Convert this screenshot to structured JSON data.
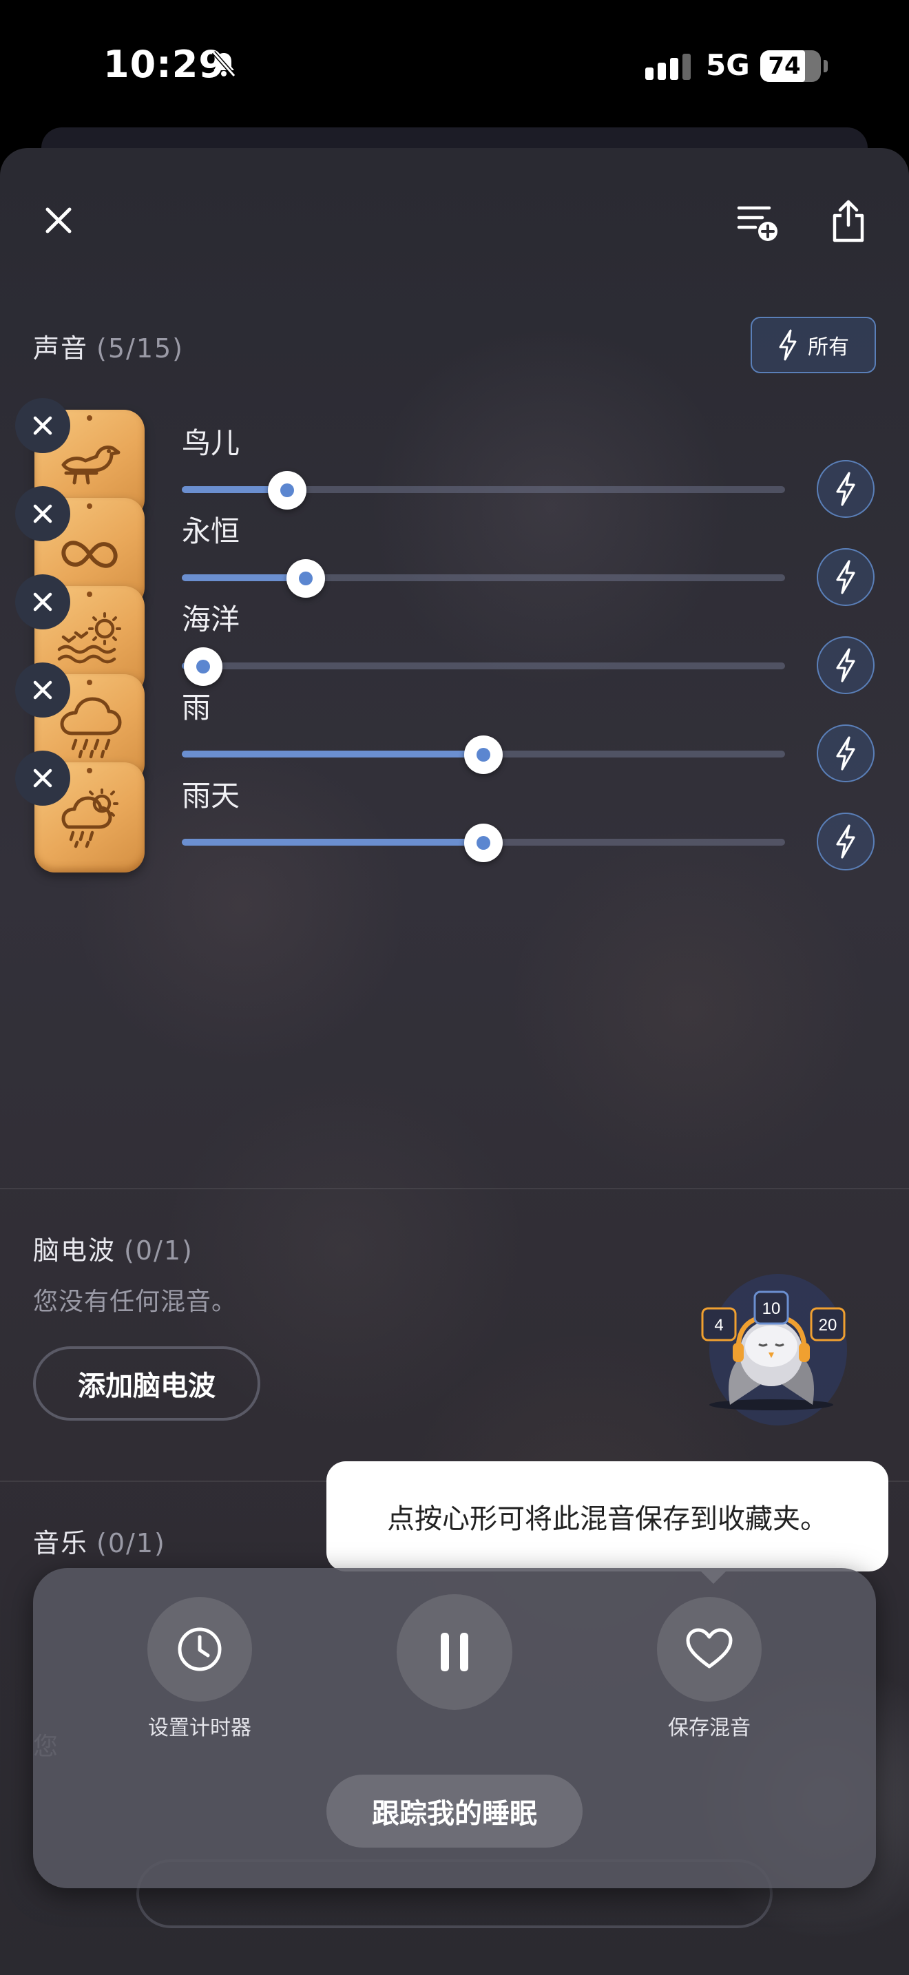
{
  "status": {
    "time": "10:29",
    "network": "5G",
    "battery": "74",
    "battery_level": 0.74
  },
  "sounds": {
    "title": "声音",
    "count": "(5/15)",
    "all_label": "所有",
    "items": [
      {
        "name": "鸟儿",
        "volume": 0.175,
        "icon": "bird-icon"
      },
      {
        "name": "永恒",
        "volume": 0.205,
        "icon": "infinity-icon"
      },
      {
        "name": "海洋",
        "volume": 0.035,
        "icon": "ocean-sun-icon"
      },
      {
        "name": "雨",
        "volume": 0.5,
        "icon": "rain-cloud-icon"
      },
      {
        "name": "雨天",
        "volume": 0.5,
        "icon": "sun-rain-cloud-icon"
      }
    ]
  },
  "brainwaves": {
    "title": "脑电波",
    "count": "(0/1)",
    "empty": "您没有任何混音。",
    "add_label": "添加脑电波"
  },
  "music": {
    "title": "音乐",
    "count": "(0/1)",
    "partial_text": "您"
  },
  "mascot": {
    "badges": [
      "4",
      "10",
      "20"
    ]
  },
  "tooltip": "点按心形可将此混音保存到收藏夹。",
  "player": {
    "timer_label": "设置计时器",
    "save_label": "保存混音",
    "track_sleep_label": "跟踪我的睡眠"
  },
  "colors": {
    "accent": "#6b8fd0",
    "tile": "#e9a85a"
  }
}
